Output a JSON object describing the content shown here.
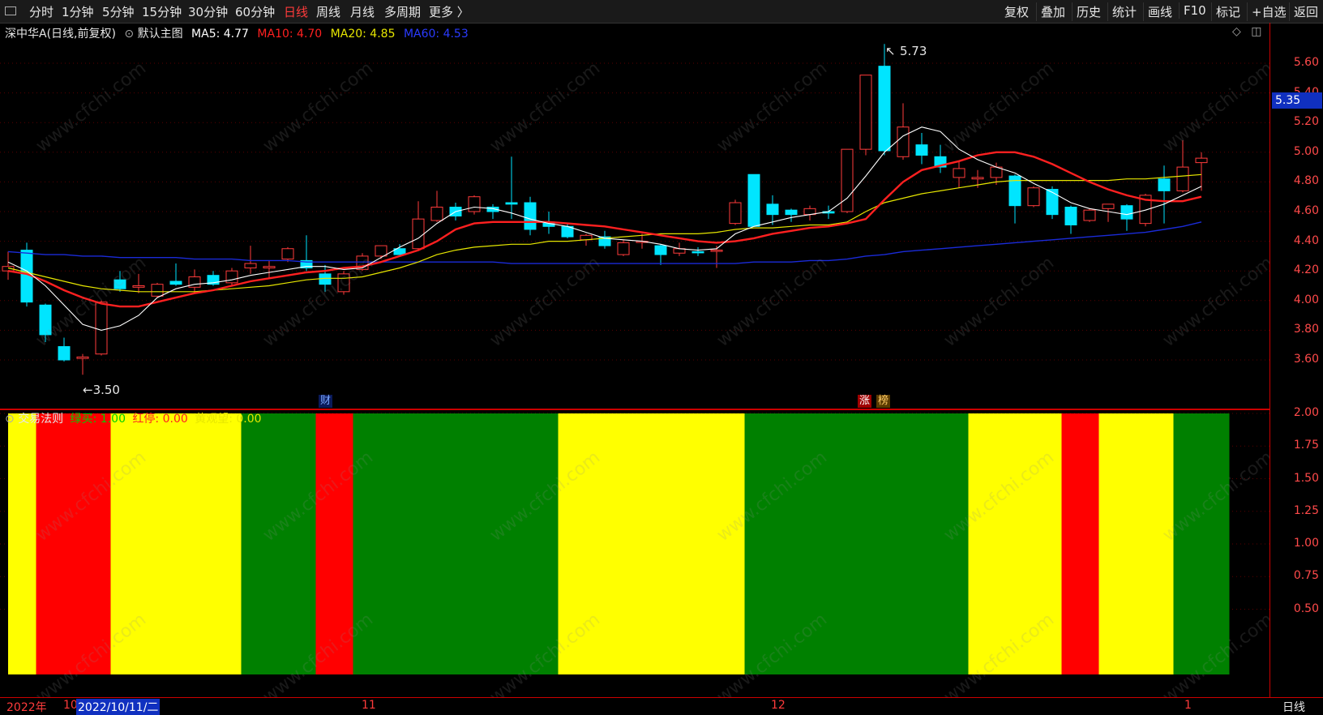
{
  "toolbar": {
    "periods": [
      "分时",
      "1分钟",
      "5分钟",
      "15分钟",
      "30分钟",
      "60分钟",
      "日线",
      "周线",
      "月线",
      "多周期",
      "更多 〉"
    ],
    "active_period": "日线",
    "right_buttons": [
      "复权",
      "叠加",
      "历史",
      "统计",
      "画线",
      "F10",
      "标记",
      "+自选",
      "返回"
    ]
  },
  "main_legend": {
    "stock": "深中华A",
    "period_info": "(日线,前复权)",
    "chart_name": "默认主图",
    "ma5": "MA5: 4.77",
    "ma10": "MA10: 4.70",
    "ma20": "MA20: 4.85",
    "ma60": "MA60: 4.53"
  },
  "indicator_legend": {
    "name": "交易法则",
    "green_buy": "绿买: 1.00",
    "red_stop": "红停: 0.00",
    "yellow_watch": "黄观望: 0.00"
  },
  "annotations": {
    "high": "5.73",
    "low": "←3.50",
    "high_arrow": "↖"
  },
  "tags": {
    "cai": "财",
    "zhang": "涨",
    "bang": "榜"
  },
  "current_price": "5.35",
  "y_axis_main": [
    "5.60",
    "5.40",
    "5.20",
    "5.00",
    "4.80",
    "4.60",
    "4.40",
    "4.20",
    "4.00",
    "3.80",
    "3.60"
  ],
  "y_axis_indicator": [
    "2.00",
    "1.75",
    "1.50",
    "1.25",
    "1.00",
    "0.75",
    "0.50"
  ],
  "date_axis": {
    "year": "2022年",
    "oct": "10",
    "cursor_date": "2022/10/11/二",
    "nov": "11",
    "dec": "12",
    "jan": "1"
  },
  "period_label": "日线",
  "watermark": "www.cfchi.com",
  "colors": {
    "up": "#ff3b3b",
    "down": "#00e5ff",
    "ma5": "#ffffff",
    "ma10": "#ff2020",
    "ma20": "#e6e600",
    "ma60": "#1a2bd8",
    "green": "#008000",
    "red": "#ff0000",
    "yellow": "#ffff00"
  },
  "chart_data": {
    "type": "candlestick",
    "y_range": [
      3.5,
      5.73
    ],
    "candles": [
      {
        "o": 4.23,
        "h": 4.33,
        "l": 4.14,
        "c": 4.2,
        "dir": "up"
      },
      {
        "o": 4.34,
        "h": 4.39,
        "l": 3.96,
        "c": 3.99,
        "dir": "down"
      },
      {
        "o": 3.97,
        "h": 3.98,
        "l": 3.72,
        "c": 3.77,
        "dir": "down"
      },
      {
        "o": 3.69,
        "h": 3.75,
        "l": 3.59,
        "c": 3.6,
        "dir": "down"
      },
      {
        "o": 3.61,
        "h": 3.64,
        "l": 3.5,
        "c": 3.62,
        "dir": "up"
      },
      {
        "o": 3.64,
        "h": 4.0,
        "l": 3.63,
        "c": 3.99,
        "dir": "up"
      },
      {
        "o": 4.14,
        "h": 4.2,
        "l": 4.06,
        "c": 4.08,
        "dir": "down"
      },
      {
        "o": 4.09,
        "h": 4.18,
        "l": 4.05,
        "c": 4.1,
        "dir": "up"
      },
      {
        "o": 4.03,
        "h": 4.12,
        "l": 4.02,
        "c": 4.11,
        "dir": "up"
      },
      {
        "o": 4.13,
        "h": 4.25,
        "l": 4.1,
        "c": 4.11,
        "dir": "down"
      },
      {
        "o": 4.09,
        "h": 4.21,
        "l": 4.05,
        "c": 4.16,
        "dir": "up"
      },
      {
        "o": 4.17,
        "h": 4.2,
        "l": 4.1,
        "c": 4.11,
        "dir": "down"
      },
      {
        "o": 4.12,
        "h": 4.22,
        "l": 4.1,
        "c": 4.2,
        "dir": "up"
      },
      {
        "o": 4.22,
        "h": 4.37,
        "l": 4.18,
        "c": 4.25,
        "dir": "up"
      },
      {
        "o": 4.23,
        "h": 4.27,
        "l": 4.15,
        "c": 4.22,
        "dir": "up"
      },
      {
        "o": 4.28,
        "h": 4.36,
        "l": 4.26,
        "c": 4.35,
        "dir": "up"
      },
      {
        "o": 4.27,
        "h": 4.44,
        "l": 4.2,
        "c": 4.22,
        "dir": "down"
      },
      {
        "o": 4.18,
        "h": 4.24,
        "l": 4.06,
        "c": 4.11,
        "dir": "down"
      },
      {
        "o": 4.06,
        "h": 4.2,
        "l": 4.04,
        "c": 4.18,
        "dir": "up"
      },
      {
        "o": 4.21,
        "h": 4.32,
        "l": 4.2,
        "c": 4.3,
        "dir": "up"
      },
      {
        "o": 4.3,
        "h": 4.37,
        "l": 4.28,
        "c": 4.37,
        "dir": "up"
      },
      {
        "o": 4.35,
        "h": 4.38,
        "l": 4.31,
        "c": 4.31,
        "dir": "down"
      },
      {
        "o": 4.35,
        "h": 4.67,
        "l": 4.34,
        "c": 4.55,
        "dir": "up"
      },
      {
        "o": 4.54,
        "h": 4.74,
        "l": 4.53,
        "c": 4.63,
        "dir": "up"
      },
      {
        "o": 4.63,
        "h": 4.66,
        "l": 4.54,
        "c": 4.57,
        "dir": "down"
      },
      {
        "o": 4.6,
        "h": 4.71,
        "l": 4.58,
        "c": 4.7,
        "dir": "up"
      },
      {
        "o": 4.63,
        "h": 4.65,
        "l": 4.55,
        "c": 4.6,
        "dir": "down"
      },
      {
        "o": 4.65,
        "h": 4.97,
        "l": 4.55,
        "c": 4.66,
        "dir": "down"
      },
      {
        "o": 4.66,
        "h": 4.7,
        "l": 4.44,
        "c": 4.48,
        "dir": "down"
      },
      {
        "o": 4.53,
        "h": 4.6,
        "l": 4.45,
        "c": 4.5,
        "dir": "down"
      },
      {
        "o": 4.5,
        "h": 4.52,
        "l": 4.42,
        "c": 4.43,
        "dir": "down"
      },
      {
        "o": 4.41,
        "h": 4.45,
        "l": 4.37,
        "c": 4.44,
        "dir": "up"
      },
      {
        "o": 4.43,
        "h": 4.47,
        "l": 4.35,
        "c": 4.37,
        "dir": "down"
      },
      {
        "o": 4.31,
        "h": 4.41,
        "l": 4.3,
        "c": 4.39,
        "dir": "up"
      },
      {
        "o": 4.4,
        "h": 4.45,
        "l": 4.35,
        "c": 4.4,
        "dir": "up"
      },
      {
        "o": 4.37,
        "h": 4.38,
        "l": 4.24,
        "c": 4.31,
        "dir": "down"
      },
      {
        "o": 4.32,
        "h": 4.39,
        "l": 4.3,
        "c": 4.35,
        "dir": "up"
      },
      {
        "o": 4.33,
        "h": 4.36,
        "l": 4.3,
        "c": 4.33,
        "dir": "down"
      },
      {
        "o": 4.34,
        "h": 4.37,
        "l": 4.22,
        "c": 4.34,
        "dir": "up"
      },
      {
        "o": 4.52,
        "h": 4.68,
        "l": 4.51,
        "c": 4.66,
        "dir": "up"
      },
      {
        "o": 4.85,
        "h": 4.85,
        "l": 4.5,
        "c": 4.5,
        "dir": "down"
      },
      {
        "o": 4.65,
        "h": 4.71,
        "l": 4.51,
        "c": 4.58,
        "dir": "down"
      },
      {
        "o": 4.61,
        "h": 4.62,
        "l": 4.53,
        "c": 4.58,
        "dir": "down"
      },
      {
        "o": 4.58,
        "h": 4.64,
        "l": 4.54,
        "c": 4.62,
        "dir": "up"
      },
      {
        "o": 4.6,
        "h": 4.64,
        "l": 4.55,
        "c": 4.59,
        "dir": "down"
      },
      {
        "o": 4.6,
        "h": 5.02,
        "l": 4.59,
        "c": 5.02,
        "dir": "up"
      },
      {
        "o": 5.02,
        "h": 5.52,
        "l": 4.98,
        "c": 5.52,
        "dir": "up"
      },
      {
        "o": 5.58,
        "h": 5.73,
        "l": 4.98,
        "c": 5.01,
        "dir": "down"
      },
      {
        "o": 4.97,
        "h": 5.33,
        "l": 4.95,
        "c": 5.17,
        "dir": "up"
      },
      {
        "o": 5.05,
        "h": 5.13,
        "l": 4.92,
        "c": 4.98,
        "dir": "down"
      },
      {
        "o": 4.97,
        "h": 5.05,
        "l": 4.86,
        "c": 4.9,
        "dir": "down"
      },
      {
        "o": 4.89,
        "h": 4.94,
        "l": 4.76,
        "c": 4.83,
        "dir": "up"
      },
      {
        "o": 4.83,
        "h": 4.88,
        "l": 4.76,
        "c": 4.82,
        "dir": "up"
      },
      {
        "o": 4.83,
        "h": 4.93,
        "l": 4.78,
        "c": 4.9,
        "dir": "up"
      },
      {
        "o": 4.84,
        "h": 4.85,
        "l": 4.52,
        "c": 4.64,
        "dir": "down"
      },
      {
        "o": 4.64,
        "h": 4.77,
        "l": 4.63,
        "c": 4.76,
        "dir": "up"
      },
      {
        "o": 4.75,
        "h": 4.77,
        "l": 4.55,
        "c": 4.58,
        "dir": "down"
      },
      {
        "o": 4.63,
        "h": 4.64,
        "l": 4.45,
        "c": 4.51,
        "dir": "down"
      },
      {
        "o": 4.54,
        "h": 4.62,
        "l": 4.53,
        "c": 4.61,
        "dir": "up"
      },
      {
        "o": 4.62,
        "h": 4.65,
        "l": 4.53,
        "c": 4.65,
        "dir": "up"
      },
      {
        "o": 4.64,
        "h": 4.65,
        "l": 4.47,
        "c": 4.55,
        "dir": "down"
      },
      {
        "o": 4.52,
        "h": 4.72,
        "l": 4.5,
        "c": 4.71,
        "dir": "up"
      },
      {
        "o": 4.82,
        "h": 4.91,
        "l": 4.52,
        "c": 4.74,
        "dir": "down"
      },
      {
        "o": 4.74,
        "h": 5.08,
        "l": 4.73,
        "c": 4.9,
        "dir": "up"
      },
      {
        "o": 4.93,
        "h": 5.0,
        "l": 4.74,
        "c": 4.96,
        "dir": "up"
      }
    ],
    "ma5": [
      4.26,
      4.2,
      4.1,
      3.97,
      3.84,
      3.8,
      3.83,
      3.9,
      4.02,
      4.08,
      4.11,
      4.12,
      4.14,
      4.17,
      4.19,
      4.21,
      4.23,
      4.23,
      4.21,
      4.22,
      4.29,
      4.36,
      4.42,
      4.52,
      4.6,
      4.63,
      4.62,
      4.59,
      4.55,
      4.52,
      4.5,
      4.46,
      4.42,
      4.41,
      4.4,
      4.38,
      4.35,
      4.34,
      4.35,
      4.45,
      4.5,
      4.53,
      4.56,
      4.58,
      4.6,
      4.69,
      4.84,
      5.0,
      5.11,
      5.17,
      5.14,
      5.02,
      4.95,
      4.9,
      4.86,
      4.79,
      4.73,
      4.66,
      4.62,
      4.6,
      4.58,
      4.61,
      4.65,
      4.71,
      4.77
    ],
    "ma10": [
      4.2,
      4.18,
      4.13,
      4.07,
      4.02,
      3.98,
      3.96,
      3.96,
      3.99,
      4.02,
      4.05,
      4.07,
      4.1,
      4.13,
      4.15,
      4.17,
      4.19,
      4.2,
      4.22,
      4.23,
      4.26,
      4.3,
      4.34,
      4.4,
      4.48,
      4.52,
      4.53,
      4.53,
      4.53,
      4.53,
      4.52,
      4.51,
      4.5,
      4.48,
      4.46,
      4.44,
      4.42,
      4.4,
      4.39,
      4.4,
      4.42,
      4.45,
      4.47,
      4.49,
      4.5,
      4.52,
      4.55,
      4.68,
      4.8,
      4.88,
      4.91,
      4.94,
      4.98,
      5.0,
      5.0,
      4.97,
      4.92,
      4.86,
      4.8,
      4.75,
      4.71,
      4.68,
      4.67,
      4.67,
      4.7
    ],
    "ma20": [
      4.22,
      4.19,
      4.16,
      4.13,
      4.1,
      4.08,
      4.07,
      4.06,
      4.06,
      4.06,
      4.06,
      4.07,
      4.08,
      4.09,
      4.1,
      4.12,
      4.14,
      4.15,
      4.15,
      4.16,
      4.19,
      4.22,
      4.26,
      4.31,
      4.34,
      4.36,
      4.37,
      4.38,
      4.38,
      4.4,
      4.4,
      4.41,
      4.42,
      4.43,
      4.44,
      4.45,
      4.45,
      4.45,
      4.46,
      4.48,
      4.49,
      4.49,
      4.5,
      4.51,
      4.51,
      4.53,
      4.6,
      4.66,
      4.69,
      4.72,
      4.74,
      4.76,
      4.78,
      4.8,
      4.81,
      4.81,
      4.81,
      4.81,
      4.81,
      4.81,
      4.82,
      4.82,
      4.83,
      4.84,
      4.85
    ],
    "ma60": [
      4.33,
      4.32,
      4.31,
      4.31,
      4.3,
      4.3,
      4.29,
      4.29,
      4.29,
      4.29,
      4.28,
      4.28,
      4.28,
      4.27,
      4.27,
      4.27,
      4.26,
      4.26,
      4.26,
      4.26,
      4.26,
      4.26,
      4.26,
      4.26,
      4.26,
      4.26,
      4.26,
      4.25,
      4.25,
      4.25,
      4.25,
      4.25,
      4.25,
      4.25,
      4.25,
      4.25,
      4.25,
      4.25,
      4.25,
      4.25,
      4.26,
      4.26,
      4.26,
      4.27,
      4.27,
      4.28,
      4.3,
      4.31,
      4.33,
      4.34,
      4.35,
      4.36,
      4.37,
      4.38,
      4.39,
      4.4,
      4.41,
      4.42,
      4.43,
      4.44,
      4.45,
      4.46,
      4.48,
      4.5,
      4.53
    ],
    "indicator_bands": [
      {
        "from": 0,
        "to": 1.5,
        "color": "yellow"
      },
      {
        "from": 1.5,
        "to": 5.5,
        "color": "red"
      },
      {
        "from": 5.5,
        "to": 12.5,
        "color": "yellow"
      },
      {
        "from": 12.5,
        "to": 16.5,
        "color": "green"
      },
      {
        "from": 16.5,
        "to": 18.5,
        "color": "red"
      },
      {
        "from": 18.5,
        "to": 29.5,
        "color": "green"
      },
      {
        "from": 29.5,
        "to": 39.5,
        "color": "yellow"
      },
      {
        "from": 39.5,
        "to": 51.5,
        "color": "green"
      },
      {
        "from": 51.5,
        "to": 56.5,
        "color": "yellow"
      },
      {
        "from": 56.5,
        "to": 58.5,
        "color": "red"
      },
      {
        "from": 58.5,
        "to": 62.5,
        "color": "yellow"
      },
      {
        "from": 62.5,
        "to": 65.5,
        "color": "green"
      }
    ],
    "indicator_value": 2.0,
    "indicator_y_range": [
      0,
      2.0
    ]
  }
}
